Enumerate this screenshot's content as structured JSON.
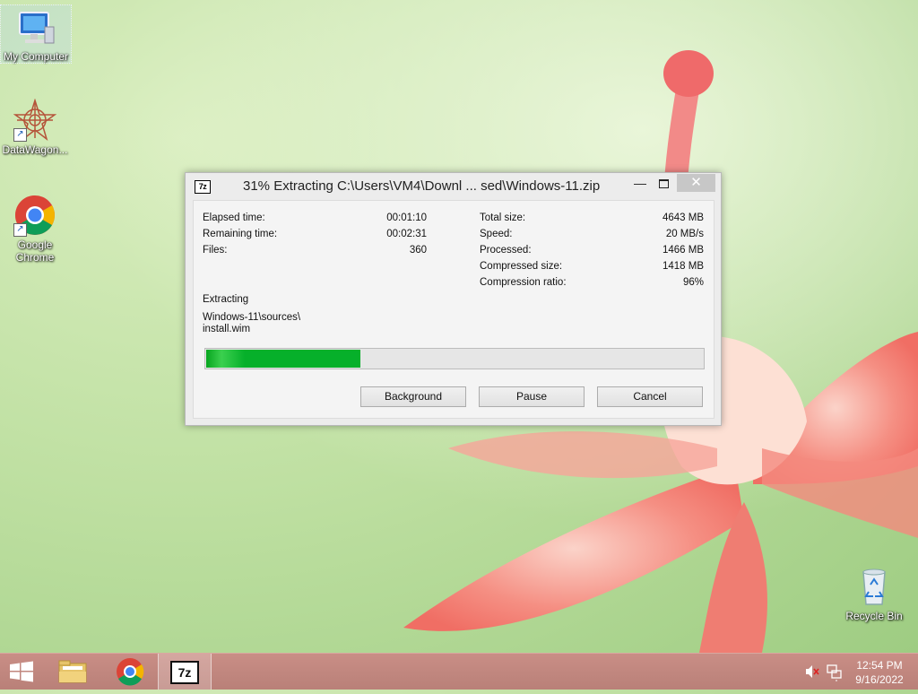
{
  "desktop": {
    "icons": [
      {
        "label": "My Computer"
      },
      {
        "label": "DataWagon..."
      },
      {
        "label": "Google Chrome"
      },
      {
        "label": "Recycle Bin"
      }
    ]
  },
  "dialog": {
    "app_icon": "7z",
    "title": "31% Extracting C:\\Users\\VM4\\Downl ... sed\\Windows-11.zip",
    "left_stats": [
      {
        "label": "Elapsed time:",
        "value": "00:01:10"
      },
      {
        "label": "Remaining time:",
        "value": "00:02:31"
      },
      {
        "label": "Files:",
        "value": "360"
      }
    ],
    "right_stats": [
      {
        "label": "Total size:",
        "value": "4643 MB"
      },
      {
        "label": "Speed:",
        "value": "20 MB/s"
      },
      {
        "label": "Processed:",
        "value": "1466 MB"
      },
      {
        "label": "Compressed size:",
        "value": "1418 MB"
      },
      {
        "label": "Compression ratio:",
        "value": "96%"
      }
    ],
    "status_label": "Extracting",
    "current_path": "Windows-11\\sources\\",
    "current_file": "install.wim",
    "progress_fraction": 0.31,
    "buttons": {
      "background": "Background",
      "pause": "Pause",
      "cancel": "Cancel"
    }
  },
  "taskbar": {
    "pinned": [
      "file-explorer-icon",
      "chrome-icon",
      "7zip-icon"
    ],
    "active_app_label": "7z",
    "clock_time": "12:54 PM",
    "clock_date": "9/16/2022"
  },
  "colors": {
    "progress": "#06b02a",
    "taskbar": "#c08880"
  }
}
